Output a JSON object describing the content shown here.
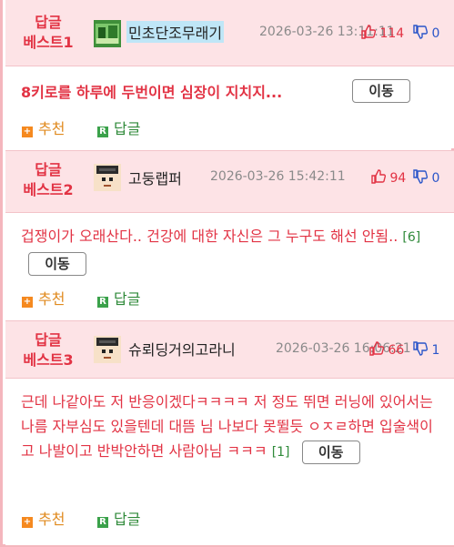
{
  "posts": [
    {
      "badge_line1": "답글",
      "badge_line2": "베스트1",
      "nickname": "민초단조무래기",
      "date": "2026-03-26 13:11:11",
      "likes": "114",
      "dislikes": "0",
      "text": "8키로를 하루에 두번이면 심장이 지치지...",
      "reply_count": "",
      "move_label": "이동",
      "recommend_label": "추천",
      "reply_label": "답글"
    },
    {
      "badge_line1": "답글",
      "badge_line2": "베스트2",
      "nickname": "고둥랩퍼",
      "date": "2026-03-26 15:42:11",
      "likes": "94",
      "dislikes": "0",
      "text": "겁쟁이가 오래산다.. 건강에 대한 자신은 그 누구도 해선 안됨..",
      "reply_count": "[6]",
      "move_label": "이동",
      "recommend_label": "추천",
      "reply_label": "답글"
    },
    {
      "badge_line1": "답글",
      "badge_line2": "베스트3",
      "nickname": "슈뢰딩거의고라니",
      "date": "2026-03-26 16:06:21",
      "likes": "66",
      "dislikes": "1",
      "text": "근데 나같아도 저 반응이겠다ㅋㅋㅋㅋ 저 정도 뛰면 러닝에 있어서는 나름 자부심도 있을텐데 대뜸 님 나보다 못뛸듯 ㅇㅈㄹ하면 입술색이고 나발이고 반박안하면 사람아님 ㅋㅋㅋ",
      "reply_count": "[1]",
      "move_label": "이동",
      "recommend_label": "추천",
      "reply_label": "답글"
    }
  ],
  "icons": {
    "thumb_up": "thumbs-up-icon",
    "thumb_down": "thumbs-down-icon",
    "recommend": "plus-square-icon",
    "reply": "r-square-icon"
  },
  "colors": {
    "accent_red": "#e23344",
    "header_bg": "#fde3e6",
    "border_pink": "#f4b6bd",
    "dislike_blue": "#2a55c9",
    "reply_green": "#2f8a3a",
    "recommend_orange": "#e08a1e"
  }
}
